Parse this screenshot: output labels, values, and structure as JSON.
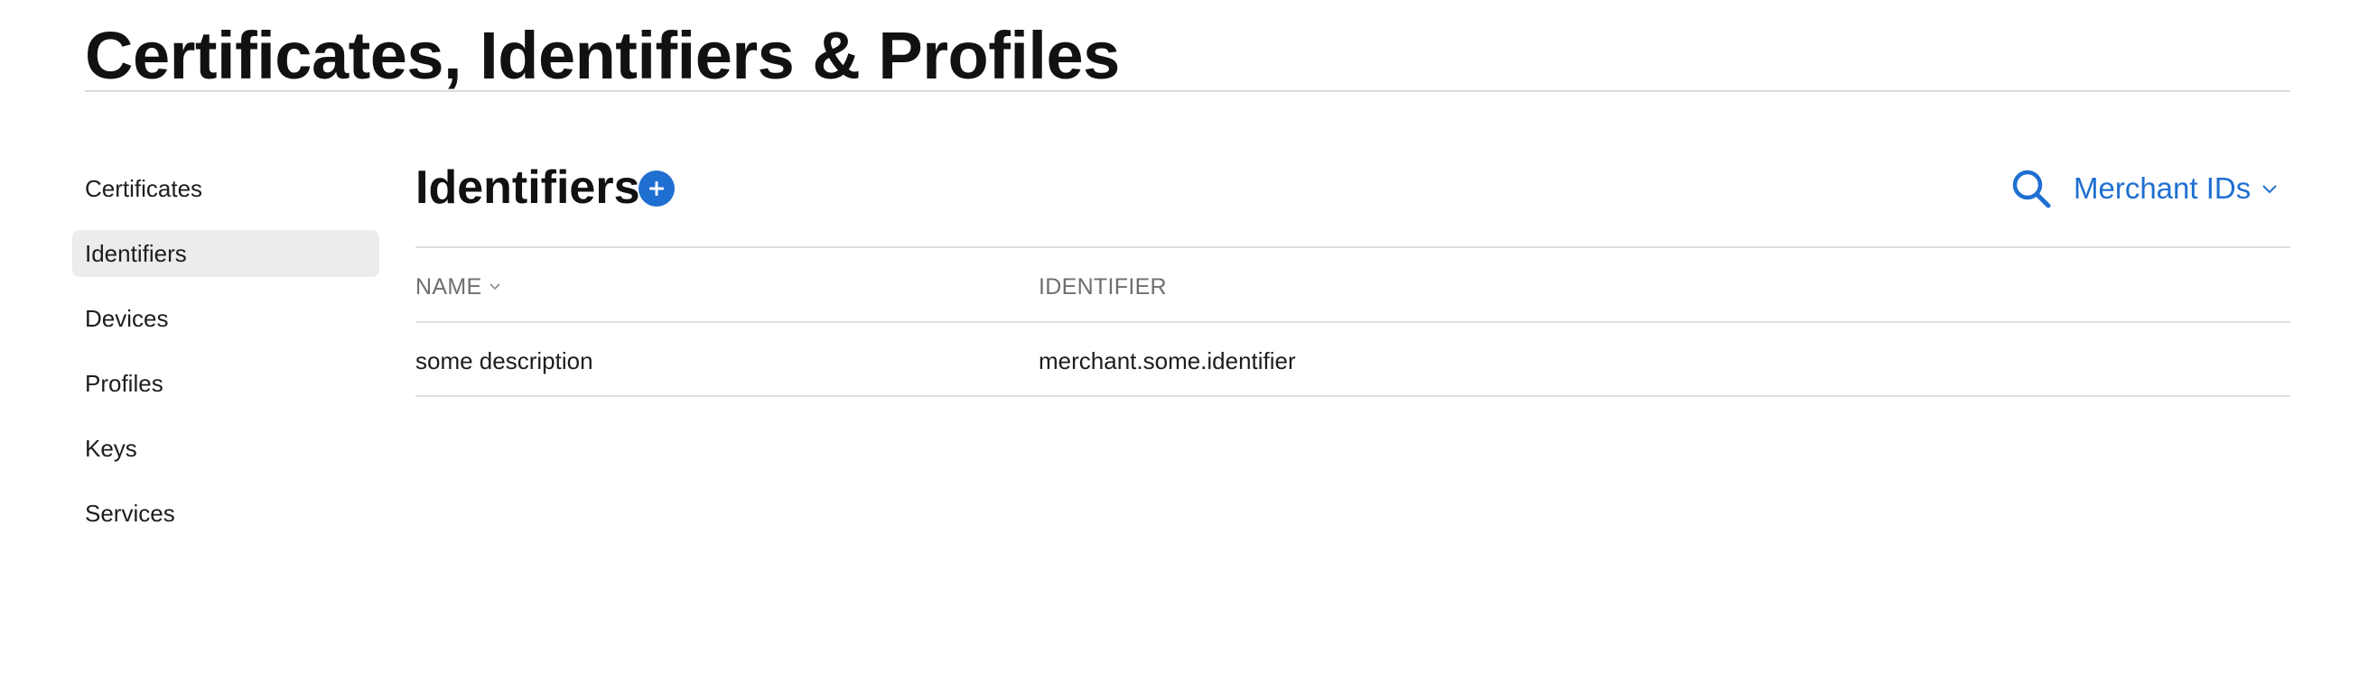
{
  "header": {
    "title": "Certificates, Identifiers & Profiles"
  },
  "sidebar": {
    "items": [
      {
        "label": "Certificates",
        "active": false
      },
      {
        "label": "Identifiers",
        "active": true
      },
      {
        "label": "Devices",
        "active": false
      },
      {
        "label": "Profiles",
        "active": false
      },
      {
        "label": "Keys",
        "active": false
      },
      {
        "label": "Services",
        "active": false
      }
    ]
  },
  "main": {
    "title": "Identifiers",
    "add_icon": "plus-circle-icon",
    "search_icon": "magnifier-icon",
    "filter": {
      "selected": "Merchant IDs",
      "icon": "chevron-down-icon"
    },
    "table": {
      "columns": [
        {
          "label": "NAME",
          "sortable": true,
          "sort_icon": "chevron-down-icon"
        },
        {
          "label": "IDENTIFIER",
          "sortable": false
        }
      ],
      "rows": [
        {
          "name": "some description",
          "identifier": "merchant.some.identifier"
        }
      ]
    }
  },
  "colors": {
    "accent": "#1f6fd1",
    "selected_background": "#ececec",
    "divider": "#e0e0e0",
    "header_text": "#6e6e73",
    "text": "#1d1d1f"
  }
}
